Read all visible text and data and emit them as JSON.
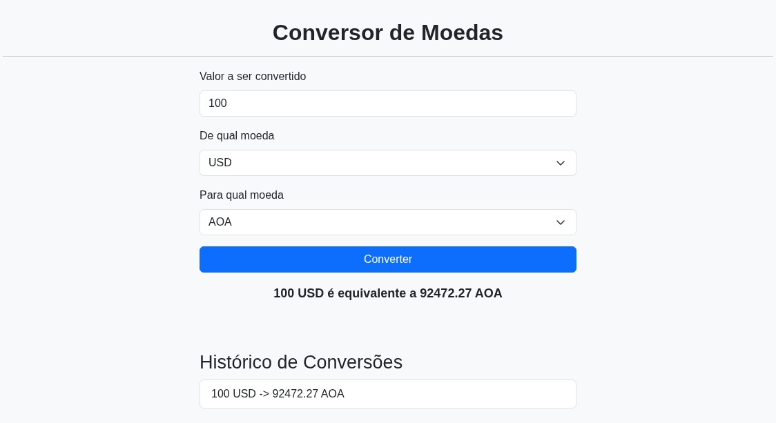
{
  "header": {
    "title": "Conversor de Moedas"
  },
  "form": {
    "fields": [
      {
        "kind": "input",
        "label": "Valor a ser convertido",
        "value": "100"
      },
      {
        "kind": "select",
        "label": "De qual moeda",
        "value": "USD"
      },
      {
        "kind": "select",
        "label": "Para qual moeda",
        "value": "AOA"
      }
    ],
    "button": "Converter"
  },
  "result": "100 USD é equivalente a 92472.27 AOA",
  "history": {
    "title": "Histórico de Conversões",
    "items": [
      "100 USD -> 92472.27 AOA"
    ]
  }
}
